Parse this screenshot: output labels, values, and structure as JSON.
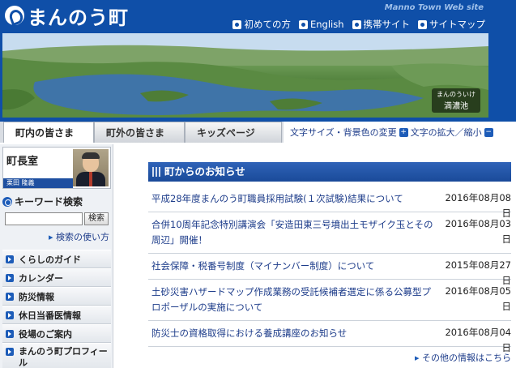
{
  "header": {
    "logo_text": "まんのう町",
    "site_label": "Manno Town Web site",
    "nav": [
      {
        "label": "初めての方"
      },
      {
        "label": "English"
      },
      {
        "label": "携帯サイト"
      },
      {
        "label": "サイトマップ"
      }
    ],
    "hero_caption_small": "まんのういけ",
    "hero_caption": "満濃池"
  },
  "tabs": [
    {
      "label": "町内の皆さま"
    },
    {
      "label": "町外の皆さま"
    },
    {
      "label": "キッズページ"
    }
  ],
  "accessibility": {
    "color_change": "文字サイズ・背景色の変更",
    "font_size": "文字の拡大／縮小",
    "plus": "+",
    "minus": "−"
  },
  "sidebar": {
    "mayor_title": "町長室",
    "mayor_name": "栗田 隆義",
    "keyword_title": "キーワード検索",
    "search_placeholder": "",
    "search_button": "検索",
    "search_help": "検索の使い方",
    "menu": [
      {
        "label": "くらしのガイド"
      },
      {
        "label": "カレンダー"
      },
      {
        "label": "防災情報"
      },
      {
        "label": "休日当番医情報"
      },
      {
        "label": "役場のご案内"
      },
      {
        "label": "まんのう町プロフィール"
      }
    ]
  },
  "news": {
    "heading": "町からのお知らせ",
    "items": [
      {
        "title": "平成28年度まんのう町職員採用試験(１次試験)結果について",
        "date": "2016年08月08日"
      },
      {
        "title": "合併10周年記念特別講演会「安造田東三号墳出土モザイク玉とその周辺」開催！",
        "date": "2016年08月03日"
      },
      {
        "title": "社会保障・税番号制度（マイナンバー制度）について",
        "date": "2015年08月27日"
      },
      {
        "title": "土砂災害ハザードマップ作成業務の受託候補者選定に係る公募型プロポーザルの実施について",
        "date": "2016年08月05日"
      },
      {
        "title": "防災士の資格取得における養成講座のお知らせ",
        "date": "2016年08月04日"
      }
    ],
    "more": "その他の情報はこちら"
  }
}
